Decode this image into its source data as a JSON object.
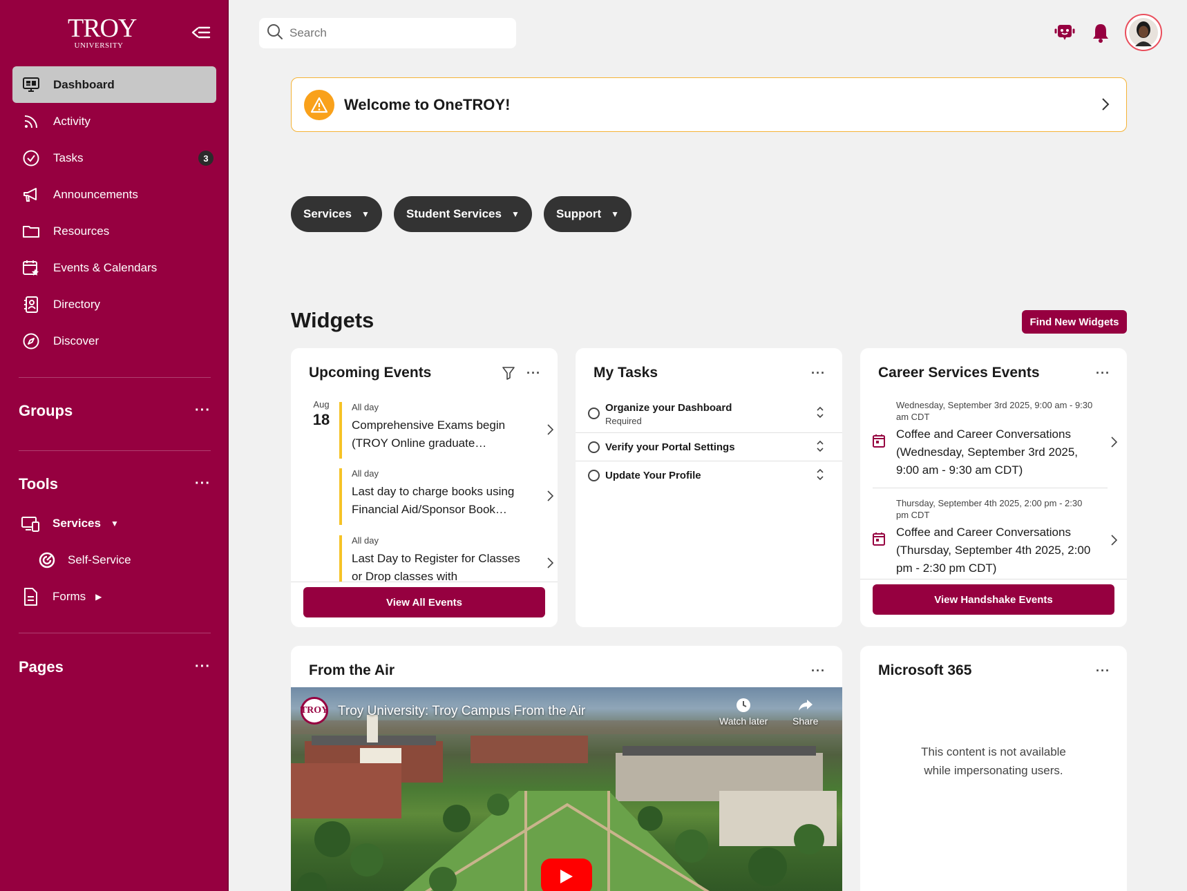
{
  "sidebar": {
    "logo_text": "TROY",
    "logo_sub": "UNIVERSITY",
    "items": [
      {
        "label": "Dashboard",
        "icon": "dashboard-icon"
      },
      {
        "label": "Activity",
        "icon": "rss-icon"
      },
      {
        "label": "Tasks",
        "icon": "check-circle-icon",
        "badge": "3"
      },
      {
        "label": "Announcements",
        "icon": "megaphone-icon"
      },
      {
        "label": "Resources",
        "icon": "folder-icon"
      },
      {
        "label": "Events & Calendars",
        "icon": "calendar-star-icon"
      },
      {
        "label": "Directory",
        "icon": "contact-book-icon"
      },
      {
        "label": "Discover",
        "icon": "compass-icon"
      }
    ],
    "groups_title": "Groups",
    "tools_title": "Tools",
    "tools": {
      "services": "Services",
      "self_service": "Self-Service",
      "forms": "Forms"
    },
    "pages_title": "Pages",
    "more": "···"
  },
  "topbar": {
    "search_placeholder": "Search"
  },
  "welcome": {
    "text": "Welcome to OneTROY!"
  },
  "pills": [
    "Services",
    "Student Services",
    "Support"
  ],
  "widgets": {
    "title": "Widgets",
    "find_button": "Find New Widgets"
  },
  "upcoming_events": {
    "title": "Upcoming Events",
    "date_month": "Aug",
    "date_day": "18",
    "events": [
      {
        "allday": "All day",
        "name": "Comprehensive Exams begin (TROY Online graduate…"
      },
      {
        "allday": "All day",
        "name": "Last day to charge books using Financial Aid/Sponsor Book…"
      },
      {
        "allday": "All day",
        "name": "Last Day to Register for Classes or Drop classes with"
      }
    ],
    "button": "View All Events"
  },
  "my_tasks": {
    "title": "My Tasks",
    "tasks": [
      {
        "name": "Organize your Dashboard",
        "sub": "Required"
      },
      {
        "name": "Verify your Portal Settings",
        "sub": ""
      },
      {
        "name": "Update Your Profile",
        "sub": ""
      }
    ]
  },
  "career_events": {
    "title": "Career Services Events",
    "events": [
      {
        "when": "Wednesday, September 3rd 2025, 9:00 am - 9:30 am CDT",
        "name": "Coffee and Career Conversations (Wednesday, September 3rd 2025, 9:00 am - 9:30 am CDT)"
      },
      {
        "when": "Thursday, September 4th 2025, 2:00 pm - 2:30 pm CDT",
        "name": "Coffee and Career Conversations (Thursday, September 4th 2025, 2:00 pm - 2:30 pm CDT)"
      }
    ],
    "button": "View Handshake Events"
  },
  "from_the_air": {
    "title": "From the Air",
    "video_title": "Troy University: Troy Campus From the Air",
    "channel_logo": "TROY",
    "watch_later": "Watch later",
    "share": "Share"
  },
  "microsoft365": {
    "title": "Microsoft 365",
    "message": "This content is not available while impersonating users."
  },
  "colors": {
    "brand": "#960040",
    "accent_yellow": "#f6c326",
    "warning": "#f9a11b",
    "pill": "#333333"
  }
}
